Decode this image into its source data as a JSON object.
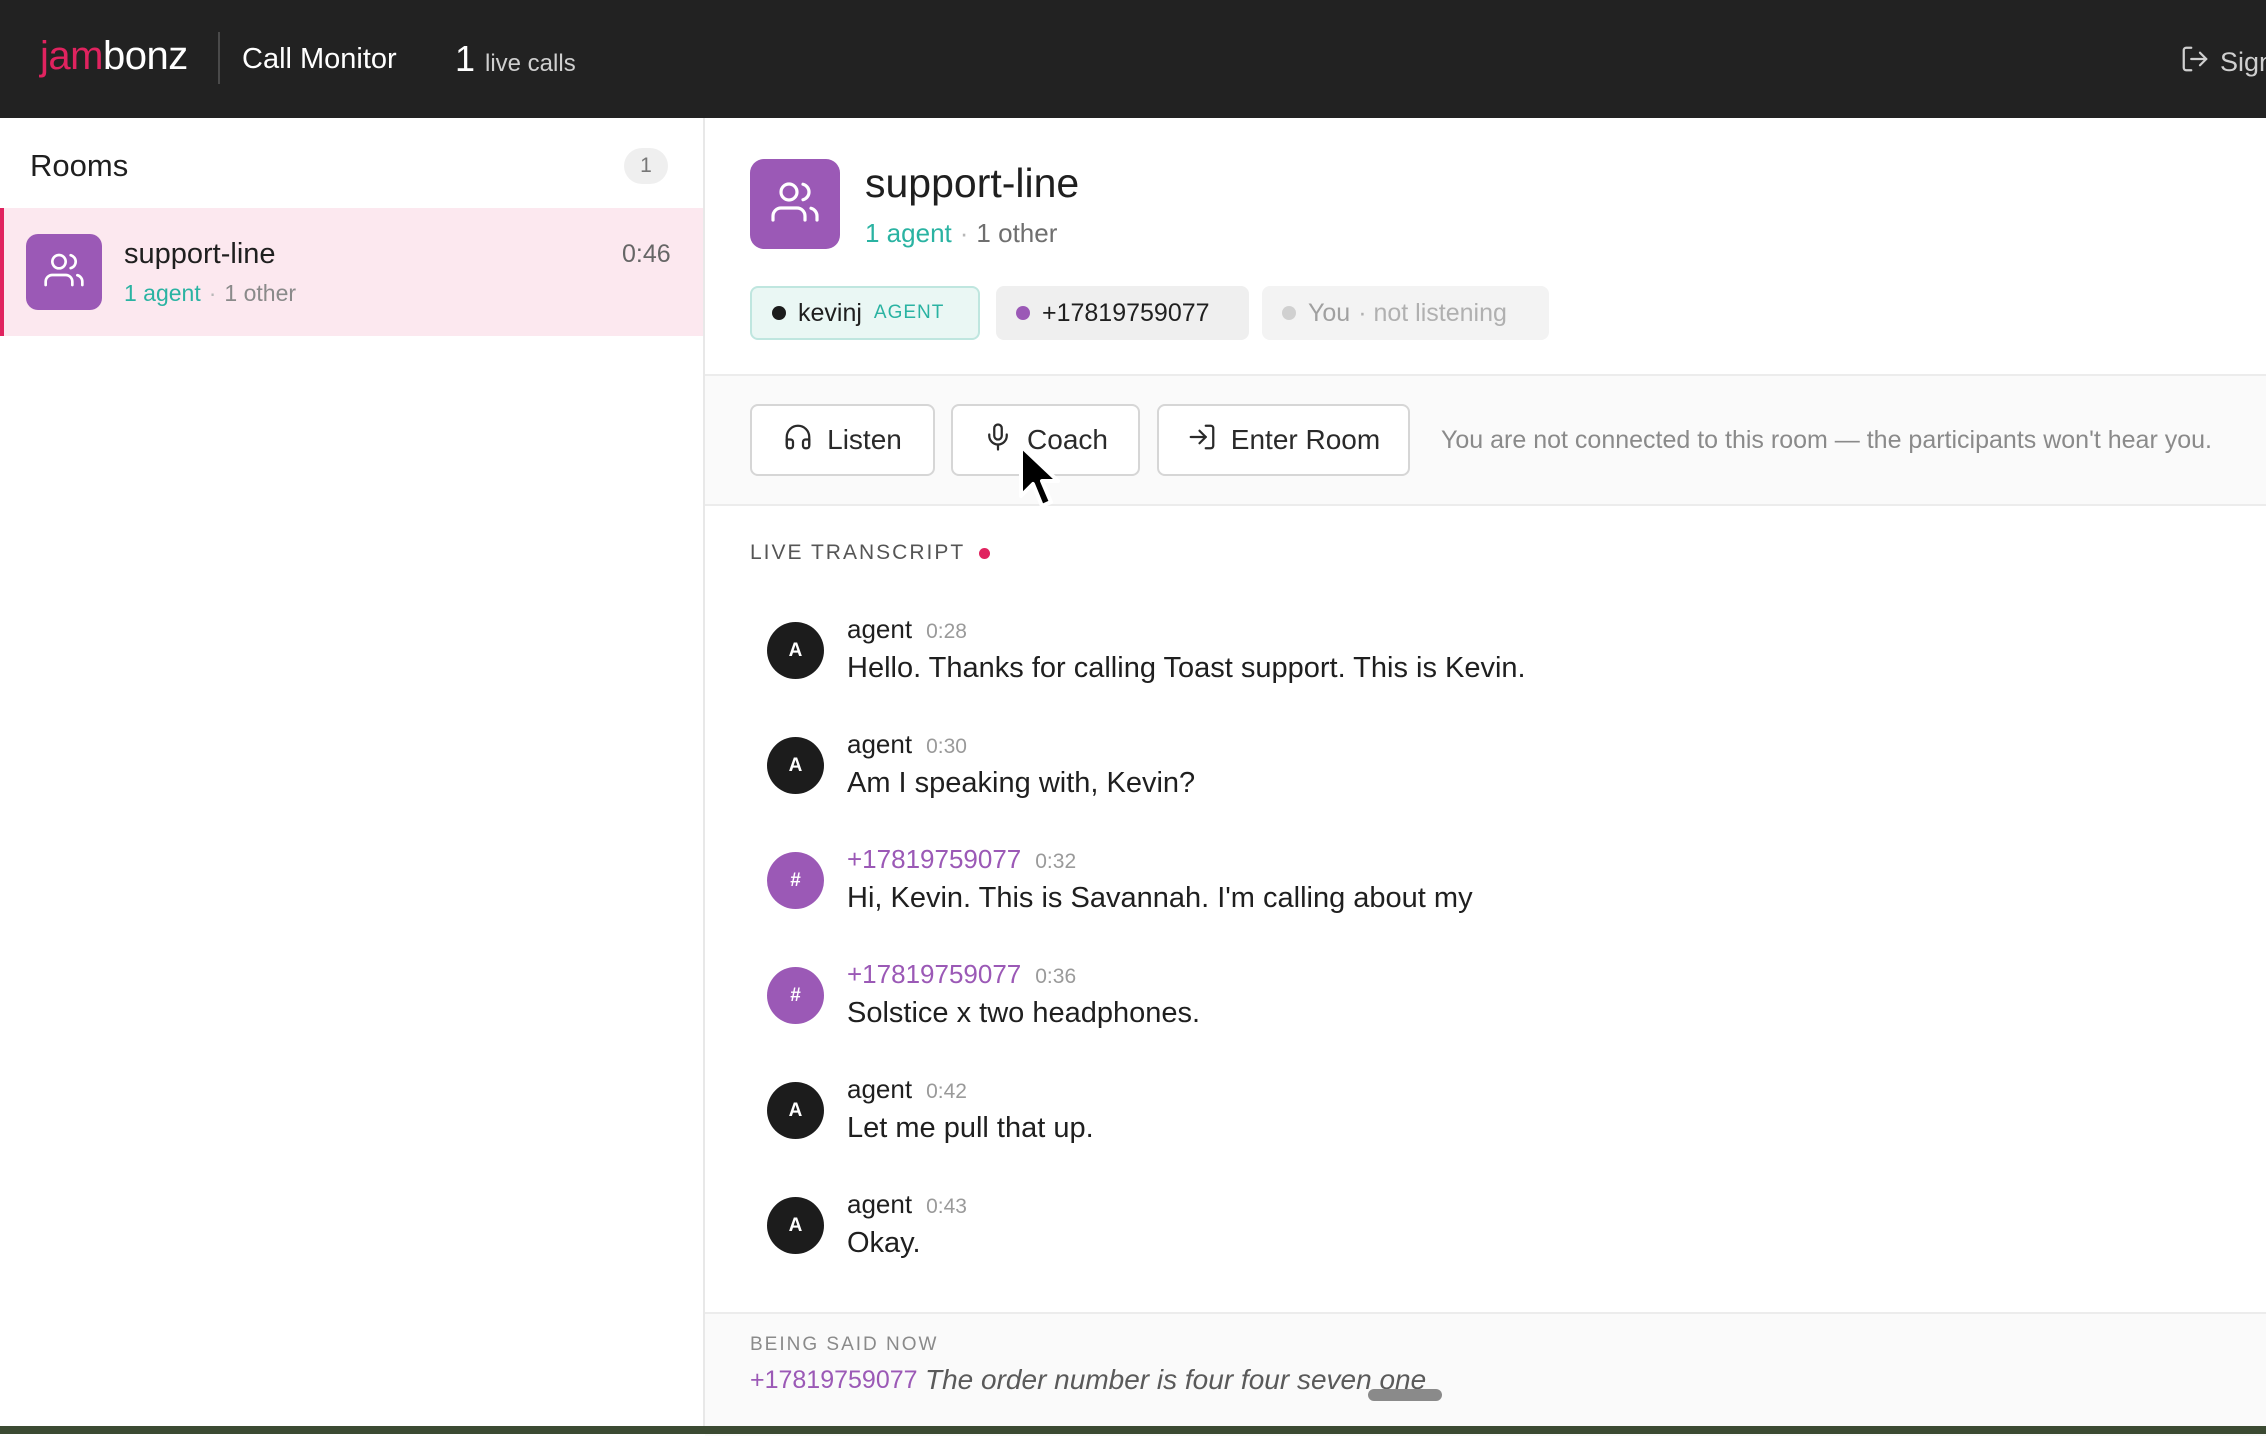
{
  "topbar": {
    "logo_part1": "jam",
    "logo_part2": "bonz",
    "app_title": "Call Monitor",
    "live_count": "1",
    "live_label": "live calls",
    "signout_label": "Sign"
  },
  "sidebar": {
    "title": "Rooms",
    "count": "1",
    "rooms": [
      {
        "name": "support-line",
        "agents": "1 agent",
        "others": "1 other",
        "duration": "0:46"
      }
    ]
  },
  "room": {
    "name": "support-line",
    "agents": "1 agent",
    "others": "1 other",
    "participants": [
      {
        "name": "kevinj",
        "role": "AGENT",
        "dot_color": "#1c1c1c"
      },
      {
        "name": "+17819759077",
        "dot_color": "#9b59b6"
      },
      {
        "name": "You",
        "status": "· not listening",
        "dot_color": "#d0d0d0"
      }
    ]
  },
  "actions": {
    "listen": "Listen",
    "coach": "Coach",
    "enter_room": "Enter Room",
    "note": "You are not connected to this room — the participants won't hear you."
  },
  "transcript": {
    "label": "LIVE TRANSCRIPT",
    "messages": [
      {
        "initial": "A",
        "speaker": "agent",
        "time": "0:28",
        "text": "Hello. Thanks for calling Toast support. This is Kevin."
      },
      {
        "initial": "A",
        "speaker": "agent",
        "time": "0:30",
        "text": "Am I speaking with, Kevin?"
      },
      {
        "initial": "#",
        "speaker": "+17819759077",
        "time": "0:32",
        "text": "Hi, Kevin. This is Savannah. I'm calling about my"
      },
      {
        "initial": "#",
        "speaker": "+17819759077",
        "time": "0:36",
        "text": "Solstice x two headphones."
      },
      {
        "initial": "A",
        "speaker": "agent",
        "time": "0:42",
        "text": "Let me pull that up."
      },
      {
        "initial": "A",
        "speaker": "agent",
        "time": "0:43",
        "text": "Okay."
      }
    ]
  },
  "being_said_now": {
    "label": "BEING SAID NOW",
    "speaker": "+17819759077",
    "text": "The order number is four four seven one"
  },
  "colors": {
    "brand": "#e0235f",
    "agent_teal": "#2ab3a2",
    "caller_purple": "#9b59b6",
    "topbar": "#222222"
  },
  "icons": {
    "signout": "sign-out-icon",
    "room": "users-icon",
    "listen": "headphones-icon",
    "coach": "microphone-icon",
    "enter": "enter-icon"
  }
}
